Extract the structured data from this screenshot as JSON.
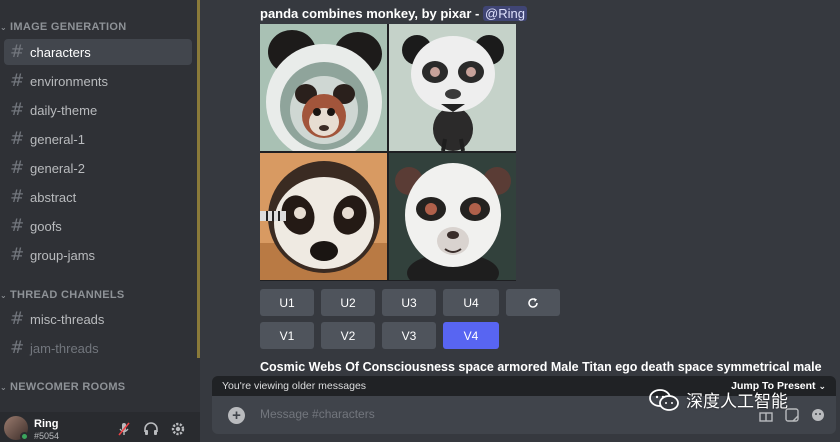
{
  "sidebar": {
    "categories": [
      {
        "label": "IMAGE GENERATION"
      },
      {
        "label": "THREAD CHANNELS"
      },
      {
        "label": "NEWCOMER ROOMS"
      }
    ],
    "channels": [
      {
        "label": "characters",
        "active": true
      },
      {
        "label": "environments"
      },
      {
        "label": "daily-theme"
      },
      {
        "label": "general-1"
      },
      {
        "label": "general-2"
      },
      {
        "label": "abstract"
      },
      {
        "label": "goofs"
      },
      {
        "label": "group-jams"
      },
      {
        "label": "misc-threads"
      },
      {
        "label": "jam-threads",
        "muted": true
      }
    ]
  },
  "user": {
    "name": "Ring",
    "tag": "#5054"
  },
  "message": {
    "prompt": "panda combines monkey, by pixar - ",
    "mention": "@Ring",
    "upscale_buttons": [
      "U1",
      "U2",
      "U3",
      "U4"
    ],
    "variation_buttons": [
      "V1",
      "V2",
      "V3",
      "V4"
    ],
    "refresh_icon": "refresh-icon",
    "selected_button": "V4"
  },
  "next_message": {
    "prompt": "Cosmic Webs Of Consciousness space armored Male Titan ego death space symmetrical male"
  },
  "banner": {
    "older_text": "You're viewing older messages",
    "jump_text": "Jump To Present"
  },
  "composer": {
    "placeholder": "Message #characters"
  },
  "watermark": {
    "text": "深度人工智能"
  },
  "colors": {
    "accent": "#5865f2",
    "sidebar": "#2f3136",
    "main": "#36393f",
    "online": "#3ba55d"
  }
}
